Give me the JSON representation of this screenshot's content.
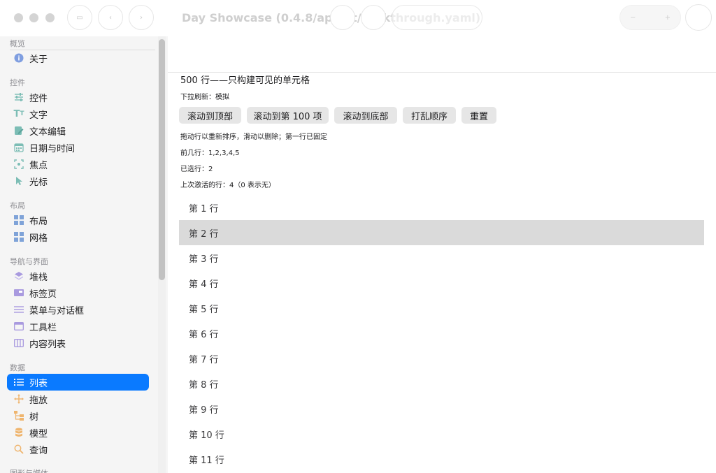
{
  "window": {
    "title": "Day Showcase (0.4.8/appkit/walkthrough.yaml)"
  },
  "sidebar": {
    "sections": [
      {
        "label": "概览"
      },
      {
        "label": "控件"
      },
      {
        "label": "布局"
      },
      {
        "label": "导航与界面"
      },
      {
        "label": "数据"
      },
      {
        "label": "图形与媒体"
      }
    ],
    "items": [
      {
        "label": "关于",
        "icon": "info-icon",
        "color": "#6f8fd8"
      },
      {
        "label": "控件",
        "icon": "sliders-icon",
        "color": "#6fb8b0"
      },
      {
        "label": "文字",
        "icon": "text-icon",
        "color": "#6fb8b0"
      },
      {
        "label": "文本编辑",
        "icon": "edit-icon",
        "color": "#6fb8b0"
      },
      {
        "label": "日期与时间",
        "icon": "calendar-icon",
        "color": "#6fb8b0"
      },
      {
        "label": "焦点",
        "icon": "focus-icon",
        "color": "#6fb8b0"
      },
      {
        "label": "光标",
        "icon": "cursor-icon",
        "color": "#6fb8b0"
      },
      {
        "label": "布局",
        "icon": "layout-icon",
        "color": "#7fa3d8"
      },
      {
        "label": "网格",
        "icon": "grid-icon",
        "color": "#7fa3d8"
      },
      {
        "label": "堆栈",
        "icon": "stack-icon",
        "color": "#a99adf"
      },
      {
        "label": "标签页",
        "icon": "tabs-icon",
        "color": "#a99adf"
      },
      {
        "label": "菜单与对话框",
        "icon": "menu-icon",
        "color": "#a99adf"
      },
      {
        "label": "工具栏",
        "icon": "toolbar-icon",
        "color": "#a99adf"
      },
      {
        "label": "内容列表",
        "icon": "columns-icon",
        "color": "#a99adf"
      },
      {
        "label": "列表",
        "icon": "list-icon",
        "color": "#ffffff"
      },
      {
        "label": "拖放",
        "icon": "move-icon",
        "color": "#efb56e"
      },
      {
        "label": "树",
        "icon": "tree-icon",
        "color": "#efb56e"
      },
      {
        "label": "模型",
        "icon": "database-icon",
        "color": "#efb56e"
      },
      {
        "label": "查询",
        "icon": "search-icon",
        "color": "#efb56e"
      }
    ]
  },
  "main": {
    "heading": "500 行——只构建可见的单元格",
    "pull_refresh": "下拉刷新：模拟",
    "buttons": [
      "滚动到顶部",
      "滚动到第 100 项",
      "滚动到底部",
      "打乱顺序",
      "重置"
    ],
    "hint": "拖动行以重新排序，滑动以删除；第一行已固定",
    "first_rows": "前几行：1,2,3,4,5",
    "selected": "已选行：2",
    "last_activated": "上次激活的行：4（0 表示无）",
    "rows": [
      "第 1 行",
      "第 2 行",
      "第 3 行",
      "第 4 行",
      "第 5 行",
      "第 6 行",
      "第 7 行",
      "第 8 行",
      "第 9 行",
      "第 10 行",
      "第 11 行"
    ],
    "selected_row": "第 2 行"
  },
  "colors": {
    "accent": "#0a7aff",
    "selection": "#dadada"
  }
}
